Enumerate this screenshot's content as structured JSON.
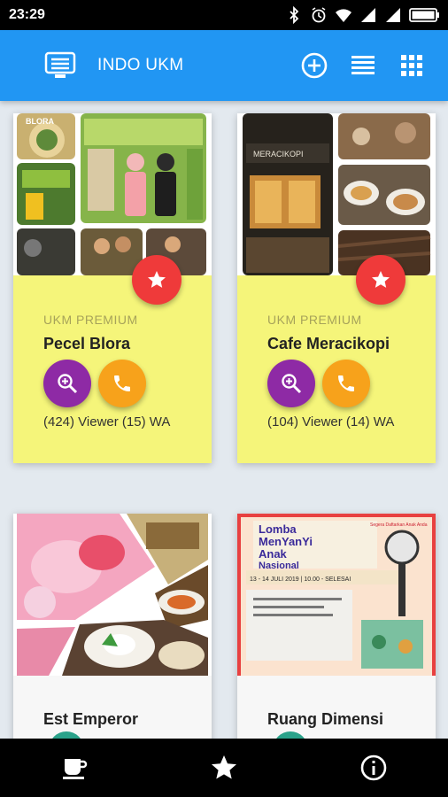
{
  "status_bar": {
    "time": "23:29",
    "icons": [
      "bluetooth-icon",
      "alarm-icon",
      "wifi-icon",
      "signal-icon",
      "signal-icon",
      "battery-icon"
    ]
  },
  "app_bar": {
    "title": "INDO UKM",
    "color": "#2196f3",
    "actions": [
      "add-circle-icon",
      "list-view-icon",
      "grid-view-icon"
    ]
  },
  "cards": [
    {
      "badge": "UKM PREMIUM",
      "title": "Pecel Blora",
      "stats": "(424) Viewer (15) WA",
      "background": "#f5f57a"
    },
    {
      "badge": "UKM PREMIUM",
      "title": "Cafe Meracikopi",
      "stats": "(104) Viewer (14) WA",
      "background": "#f5f57a"
    },
    {
      "title": "Est Emperor",
      "background": "#f7f7f7"
    },
    {
      "title": "Ruang Dimensi",
      "background": "#f7f7f7",
      "poster": {
        "headline": [
          "Lomba",
          "MenYanYi",
          "Anak",
          "Nasional"
        ],
        "date": "13 - 14 JULI 2019 | 10.00 - SELESAI",
        "corner": "Segera Daftarkan Anak Anda"
      }
    }
  ],
  "photo_texts": {
    "pecel_logo": "BLORA",
    "cafe_sign": "MERACIKOPI"
  },
  "colors": {
    "star_button": "#ef3a3a",
    "view_button": "#8e2aa5",
    "call_button": "#f7a21b"
  },
  "bottom_nav": [
    "coffee-cup-icon",
    "star-icon",
    "info-icon"
  ]
}
